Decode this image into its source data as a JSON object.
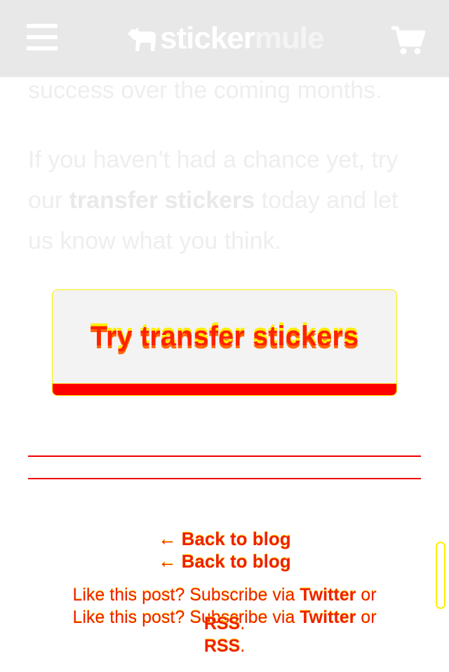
{
  "header": {
    "logo_part1": "sticker",
    "logo_part2": "mule",
    "menu_icon": "hamburger-icon",
    "cart_icon": "shopping-cart-icon"
  },
  "article": {
    "para1": "success over the coming months.",
    "para2_before": "If you haven’t had a chance yet, try our ",
    "para2_bold": "transfer stickers",
    "para2_after": " today and let us know what you think."
  },
  "cta": {
    "label": "Try transfer stickers"
  },
  "footer": {
    "back_link": "← Back to blog",
    "subscribe_prefix": "Like this post? Subscribe via ",
    "twitter": "Twitter",
    "or": " or",
    "rss": "RSS",
    "period": "."
  },
  "colors": {
    "header_bg": "#e8e8e8",
    "accent_red": "#ff0000",
    "accent_yellow": "#ffee00"
  }
}
